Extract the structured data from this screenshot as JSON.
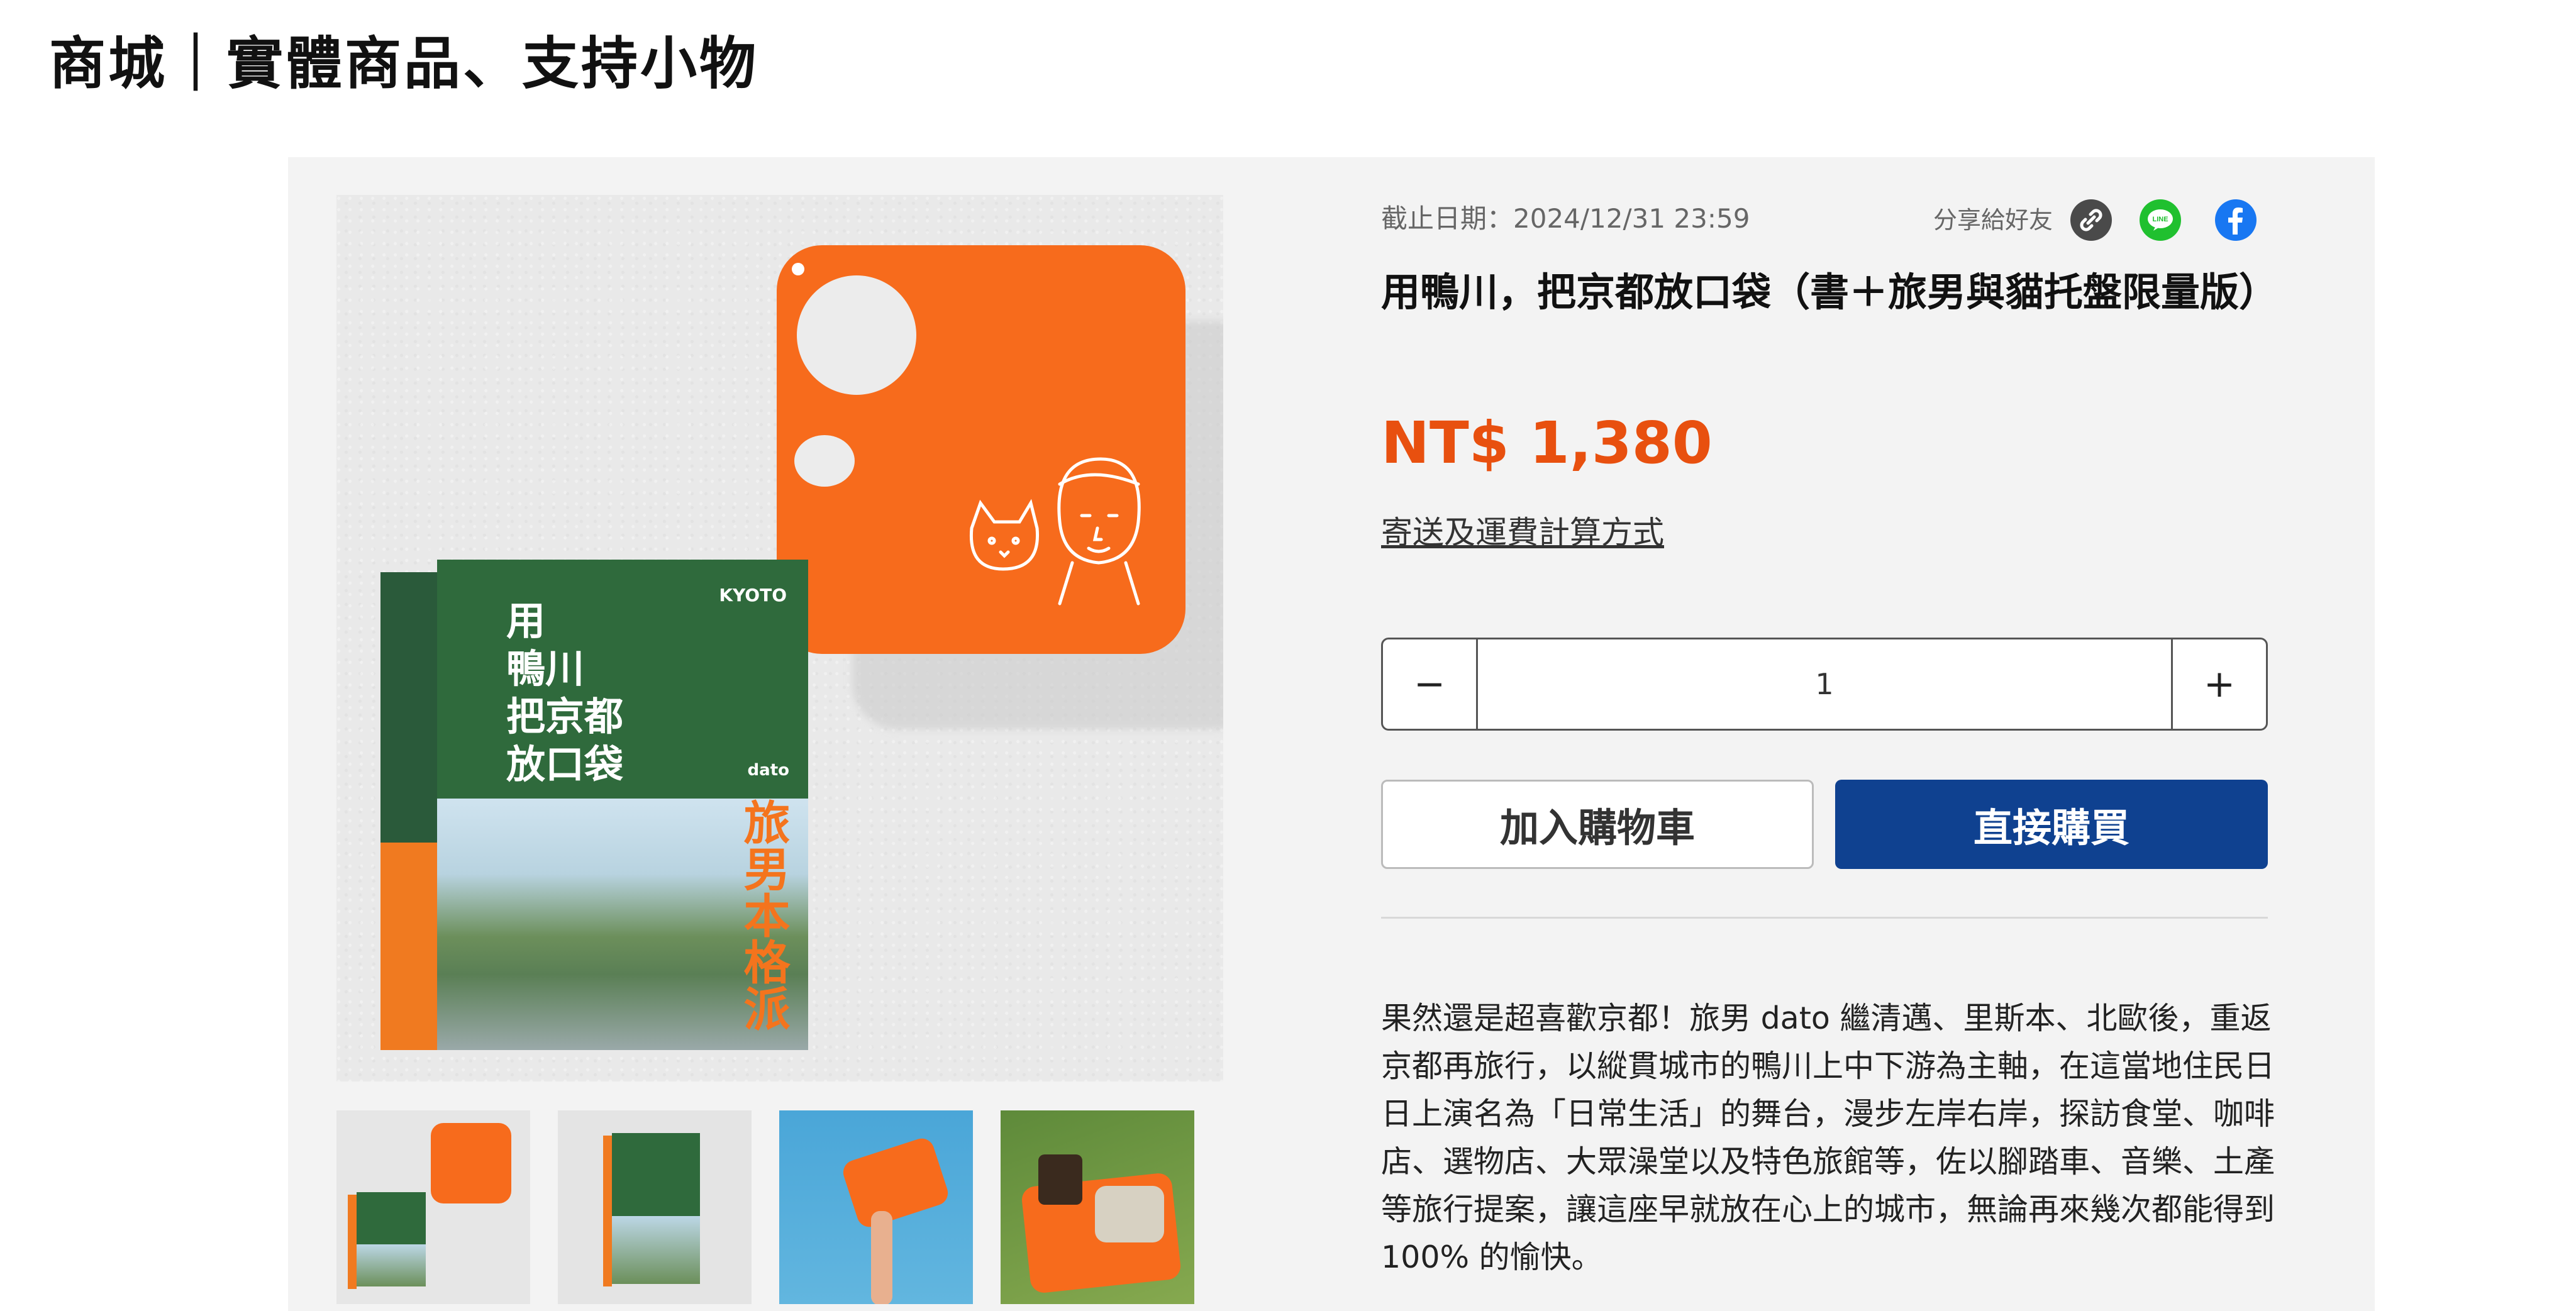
{
  "page": {
    "heading": "商城｜實體商品、支持小物"
  },
  "gallery": {
    "book_title_lines": [
      "用",
      "鴨川",
      "把京都",
      "放口袋"
    ],
    "book_brand": "KYOTO",
    "book_author": "dato",
    "book_orange_title": "旅男本格派",
    "thumbnails": [
      "book-and-tray",
      "book-cover",
      "tray-in-sky",
      "tray-on-grass"
    ]
  },
  "info": {
    "deadline": "截止日期：2024/12/31 23:59",
    "share_label": "分享給好友",
    "title": "用鴨川，把京都放口袋（書＋旅男與貓托盤限量版）",
    "price": "NT$ 1,380",
    "shipping_link": "寄送及運費計算方式",
    "quantity": {
      "minus": "−",
      "value": "1",
      "plus": "+"
    },
    "add_to_cart": "加入購物車",
    "buy_now": "直接購買",
    "description": "果然還是超喜歡京都！旅男 dato 繼清邁、里斯本、北歐後，重返京都再旅行，以縱貫城市的鴨川上中下游為主軸，在這當地住民日日上演名為「日常生活」的舞台，漫步左岸右岸，探訪食堂、咖啡店、選物店、大眾澡堂以及特色旅館等，佐以腳踏車、音樂、土產等旅行提案，讓這座早就放在心上的城市，無論再來幾次都能得到 100% 的愉快。"
  },
  "icons": {
    "share_link": "link-icon",
    "share_line": "line-icon",
    "share_facebook": "facebook-icon"
  },
  "colors": {
    "price": "#e8500f",
    "buy_button": "#0f4190",
    "tray": "#f76b1c",
    "book_green": "#2f6a3c"
  }
}
